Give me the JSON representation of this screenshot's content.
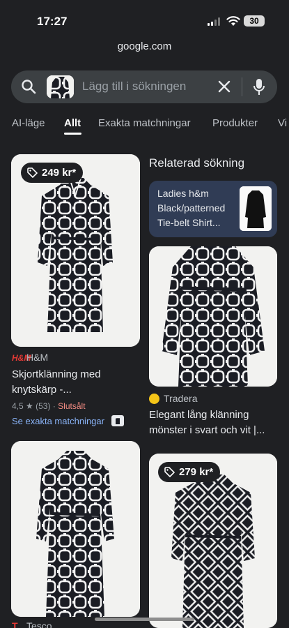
{
  "status_bar": {
    "time": "17:27",
    "battery": "30"
  },
  "browser": {
    "url": "google.com"
  },
  "search": {
    "placeholder": "Lägg till i sökningen"
  },
  "tabs": [
    {
      "label": "AI-läge"
    },
    {
      "label": "Allt",
      "active": true
    },
    {
      "label": "Exakta matchningar"
    },
    {
      "label": "Produkter"
    },
    {
      "label": "Vi"
    }
  ],
  "results": {
    "card1": {
      "price": "249 kr*",
      "source": "H&M",
      "logo": "H&M",
      "title": "Skjortklänning med knytskärp -...",
      "rating": "4,5",
      "reviews": "(53)",
      "stock": "Slutsålt",
      "exact_link": "Se exakta matchningar"
    },
    "related": {
      "heading": "Relaterad sökning",
      "text": "Ladies h&m Black/patterned Tie-belt Shirt..."
    },
    "card2": {
      "source": "Tradera",
      "title": "Elegant lång klänning mönster i svart och vit |..."
    },
    "card3": {
      "source": "Tesco",
      "logo": "T"
    },
    "card4": {
      "price": "279 kr*"
    }
  },
  "colors": {
    "background": "#1f2023",
    "search_box": "#3c4043",
    "link": "#8ab4f8",
    "soldout": "#f28b82",
    "related_card": "#303c55"
  }
}
